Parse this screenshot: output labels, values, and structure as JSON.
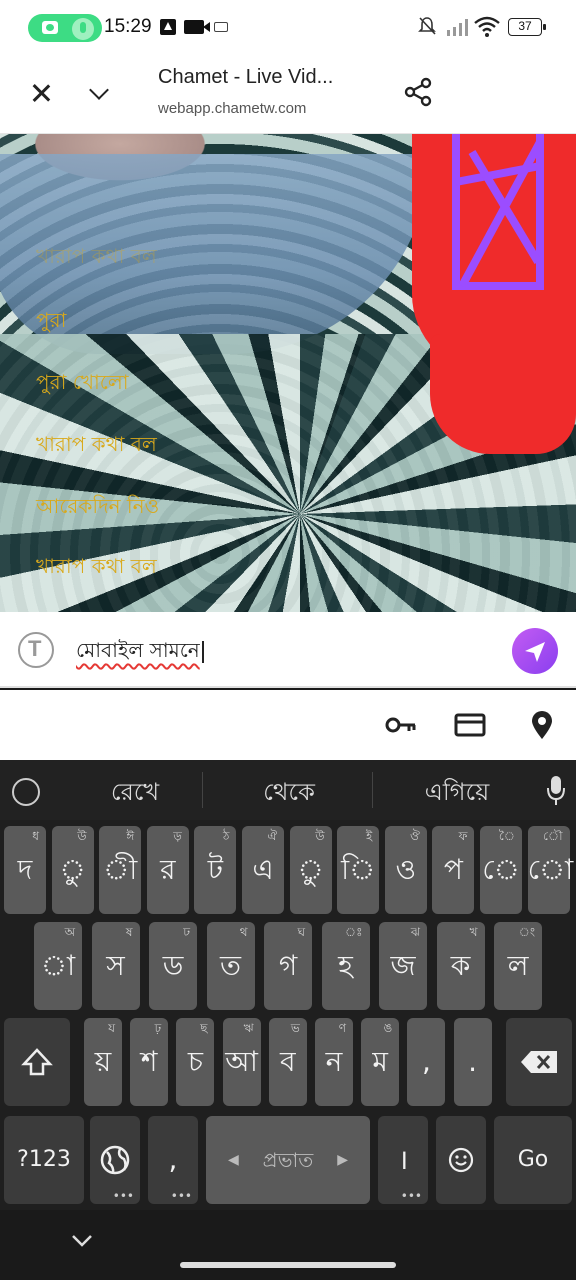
{
  "status_bar": {
    "time": "15:29",
    "battery": "37"
  },
  "tab": {
    "title": "Chamet - Live Vid...",
    "url": "webapp.chametw.com"
  },
  "chat": {
    "messages": [
      "খারাপ কথা বল",
      "পুরা",
      "পুরা খোলো",
      "খারাপ কথা বল",
      "আরেকদিন নিও",
      "খারাপ কথা বল"
    ]
  },
  "input": {
    "value": "মোবাইল সামনে"
  },
  "keyboard": {
    "suggestions": [
      "রেখে",
      "থেকে",
      "এগিয়ে"
    ],
    "row1": [
      {
        "label": "দ",
        "hint": "ধ"
      },
      {
        "label": "ু",
        "hint": "উ"
      },
      {
        "label": "ী",
        "hint": "ঈ"
      },
      {
        "label": "র",
        "hint": "ড়"
      },
      {
        "label": "ট",
        "hint": "ঠ"
      },
      {
        "label": "এ",
        "hint": "ঐ"
      },
      {
        "label": "ু",
        "hint": "উ"
      },
      {
        "label": "ি",
        "hint": "ই"
      },
      {
        "label": "ও",
        "hint": "ঔ"
      },
      {
        "label": "প",
        "hint": "ফ"
      },
      {
        "label": "ে",
        "hint": "ৈ"
      },
      {
        "label": "ো",
        "hint": "ৌ"
      }
    ],
    "row2": [
      {
        "label": "া",
        "hint": "অ"
      },
      {
        "label": "স",
        "hint": "ষ"
      },
      {
        "label": "ড",
        "hint": "ঢ"
      },
      {
        "label": "ত",
        "hint": "থ"
      },
      {
        "label": "গ",
        "hint": "ঘ"
      },
      {
        "label": "হ",
        "hint": "ঃ"
      },
      {
        "label": "জ",
        "hint": "ঝ"
      },
      {
        "label": "ক",
        "hint": "খ"
      },
      {
        "label": "ল",
        "hint": "ং"
      }
    ],
    "row3": [
      {
        "label": "য়",
        "hint": "য"
      },
      {
        "label": "শ",
        "hint": "ঢ়"
      },
      {
        "label": "চ",
        "hint": "ছ"
      },
      {
        "label": "আ",
        "hint": "ঋ"
      },
      {
        "label": "ব",
        "hint": "ভ"
      },
      {
        "label": "ন",
        "hint": "ণ"
      },
      {
        "label": "ম",
        "hint": "ঙ"
      },
      {
        "label": ",",
        "hint": ""
      },
      {
        "label": ".",
        "hint": ""
      }
    ],
    "symbols_key": "?123",
    "comma_key": ",",
    "space_label": "প্রভাত",
    "period_key": "।",
    "go_key": "Go"
  },
  "colors": {
    "chat_text": "#d9a91b",
    "send_button": "#a14cf1",
    "key": "#5a5a5a",
    "key_dark": "#3b3b3b"
  }
}
